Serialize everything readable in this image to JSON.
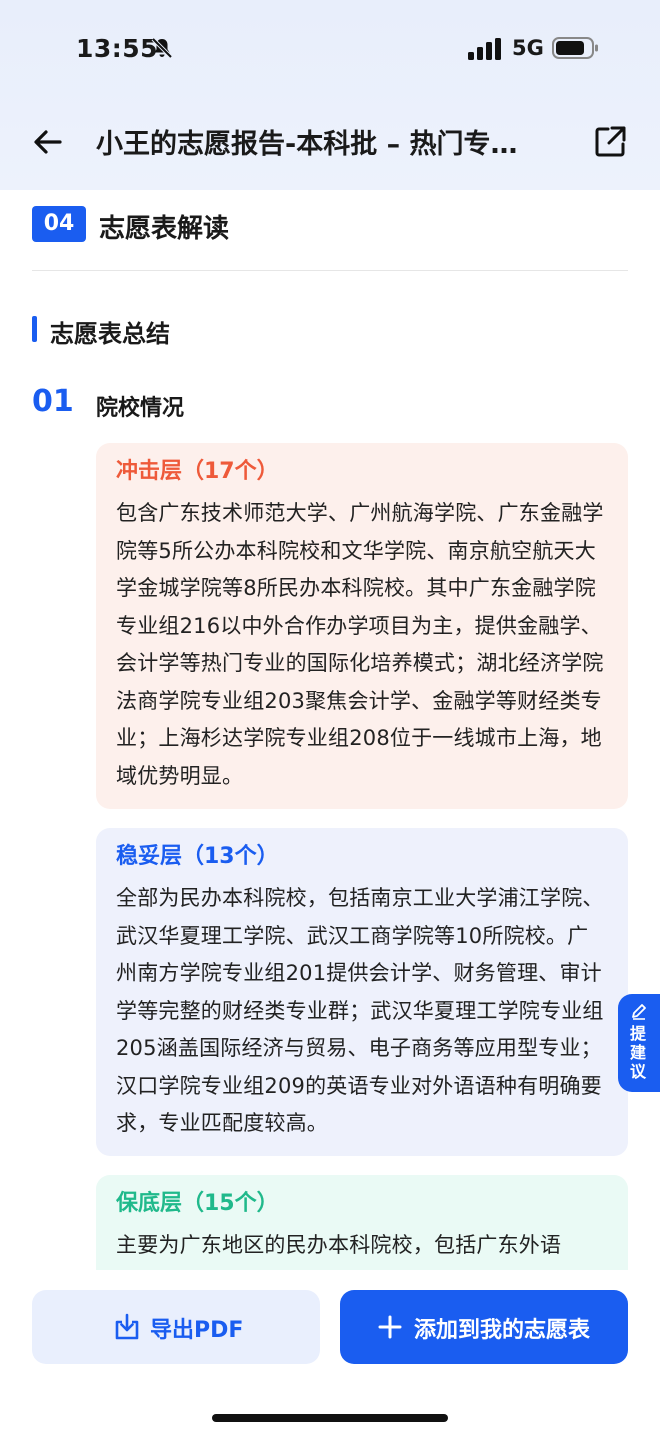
{
  "status_bar": {
    "time": "13:55",
    "network": "5G"
  },
  "nav": {
    "title": "小王的志愿报告-本科批 – 热门专…"
  },
  "section": {
    "number": "04",
    "title": "志愿表解读"
  },
  "summary": {
    "title": "志愿表总结",
    "item_number": "01",
    "item_title": "院校情况",
    "cards": [
      {
        "title": "冲击层（17个）",
        "body": "包含广东技术师范大学、广州航海学院、广东金融学院等5所公办本科院校和文华学院、南京航空航天大学金城学院等8所民办本科院校。其中广东金融学院专业组216以中外合作办学项目为主，提供金融学、会计学等热门专业的国际化培养模式；湖北经济学院法商学院专业组203聚焦会计学、金融学等财经类专业；上海杉达学院专业组208位于一线城市上海，地域优势明显。"
      },
      {
        "title": "稳妥层（13个）",
        "body": "全部为民办本科院校，包括南京工业大学浦江学院、武汉华夏理工学院、武汉工商学院等10所院校。广州南方学院专业组201提供会计学、财务管理、审计学等完整的财经类专业群；武汉华夏理工学院专业组205涵盖国际经济与贸易、电子商务等应用型专业；汉口学院专业组209的英语专业对外语语种有明确要求，专业匹配度较高。"
      },
      {
        "title": "保底层（15个）",
        "body": "主要为广东地区的民办本科院校，包括广东外语"
      }
    ]
  },
  "float_button": {
    "label": "提建议"
  },
  "bottom": {
    "export_label": "导出PDF",
    "add_label": "添加到我的志愿表"
  },
  "colors": {
    "primary": "#1a5df0",
    "rush": "#ee5a3a",
    "stable": "#1a5df0",
    "safe": "#20b98b"
  }
}
